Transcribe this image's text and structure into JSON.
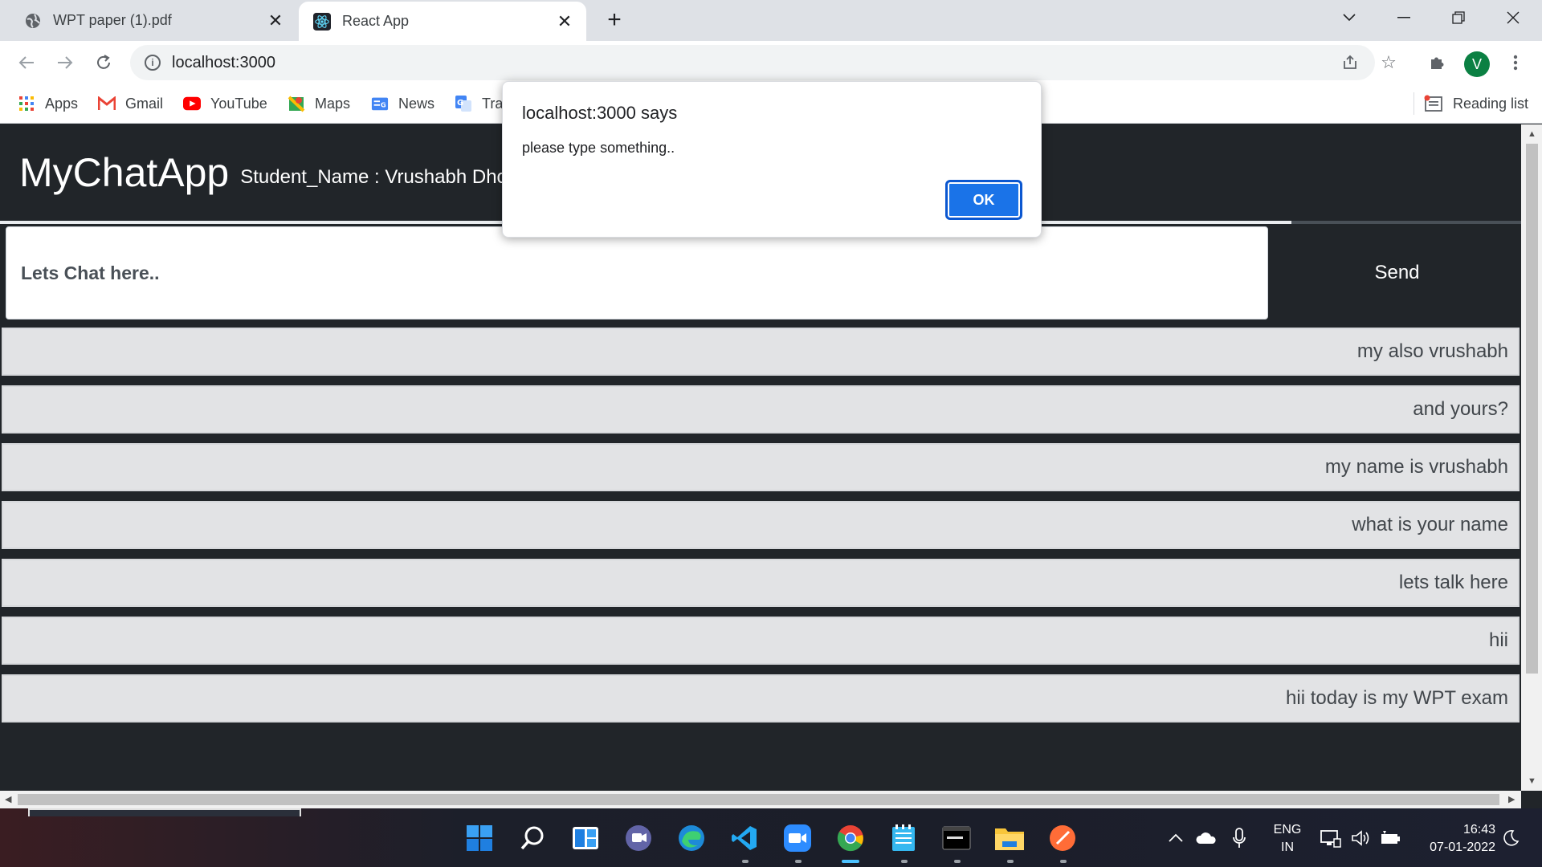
{
  "browser": {
    "tabs": [
      {
        "label": "WPT paper (1).pdf",
        "icon": "globe-icon",
        "active": false
      },
      {
        "label": "React App",
        "icon": "react-icon",
        "active": true
      }
    ],
    "url": "localhost:3000",
    "profile_initial": "V",
    "bookmarks": [
      {
        "label": "Apps",
        "icon": "apps-grid-icon"
      },
      {
        "label": "Gmail",
        "icon": "gmail-icon"
      },
      {
        "label": "YouTube",
        "icon": "youtube-icon"
      },
      {
        "label": "Maps",
        "icon": "maps-icon"
      },
      {
        "label": "News",
        "icon": "news-icon"
      },
      {
        "label": "Tra",
        "icon": "translate-icon"
      }
    ],
    "reading_list": "Reading list"
  },
  "app": {
    "brand": "MyChatApp",
    "student_name": "Student_Name : Vrushabh Dhon",
    "input_placeholder": "Lets Chat here..",
    "send_label": "Send",
    "messages": [
      "my also vrushabh",
      "and yours?",
      "my name is vrushabh",
      "what is your name",
      "lets talk here",
      "hii",
      "hii today is my WPT exam"
    ]
  },
  "dialog": {
    "title": "localhost:3000 says",
    "message": "please type something..",
    "ok_label": "OK"
  },
  "taskbar": {
    "language_line1": "ENG",
    "language_line2": "IN",
    "time": "16:43",
    "date": "07-01-2022"
  },
  "colors": {
    "page_bg": "#212529",
    "message_bg": "#e2e3e5",
    "ok_button": "#1a73e8",
    "profile": "#0b8043"
  }
}
